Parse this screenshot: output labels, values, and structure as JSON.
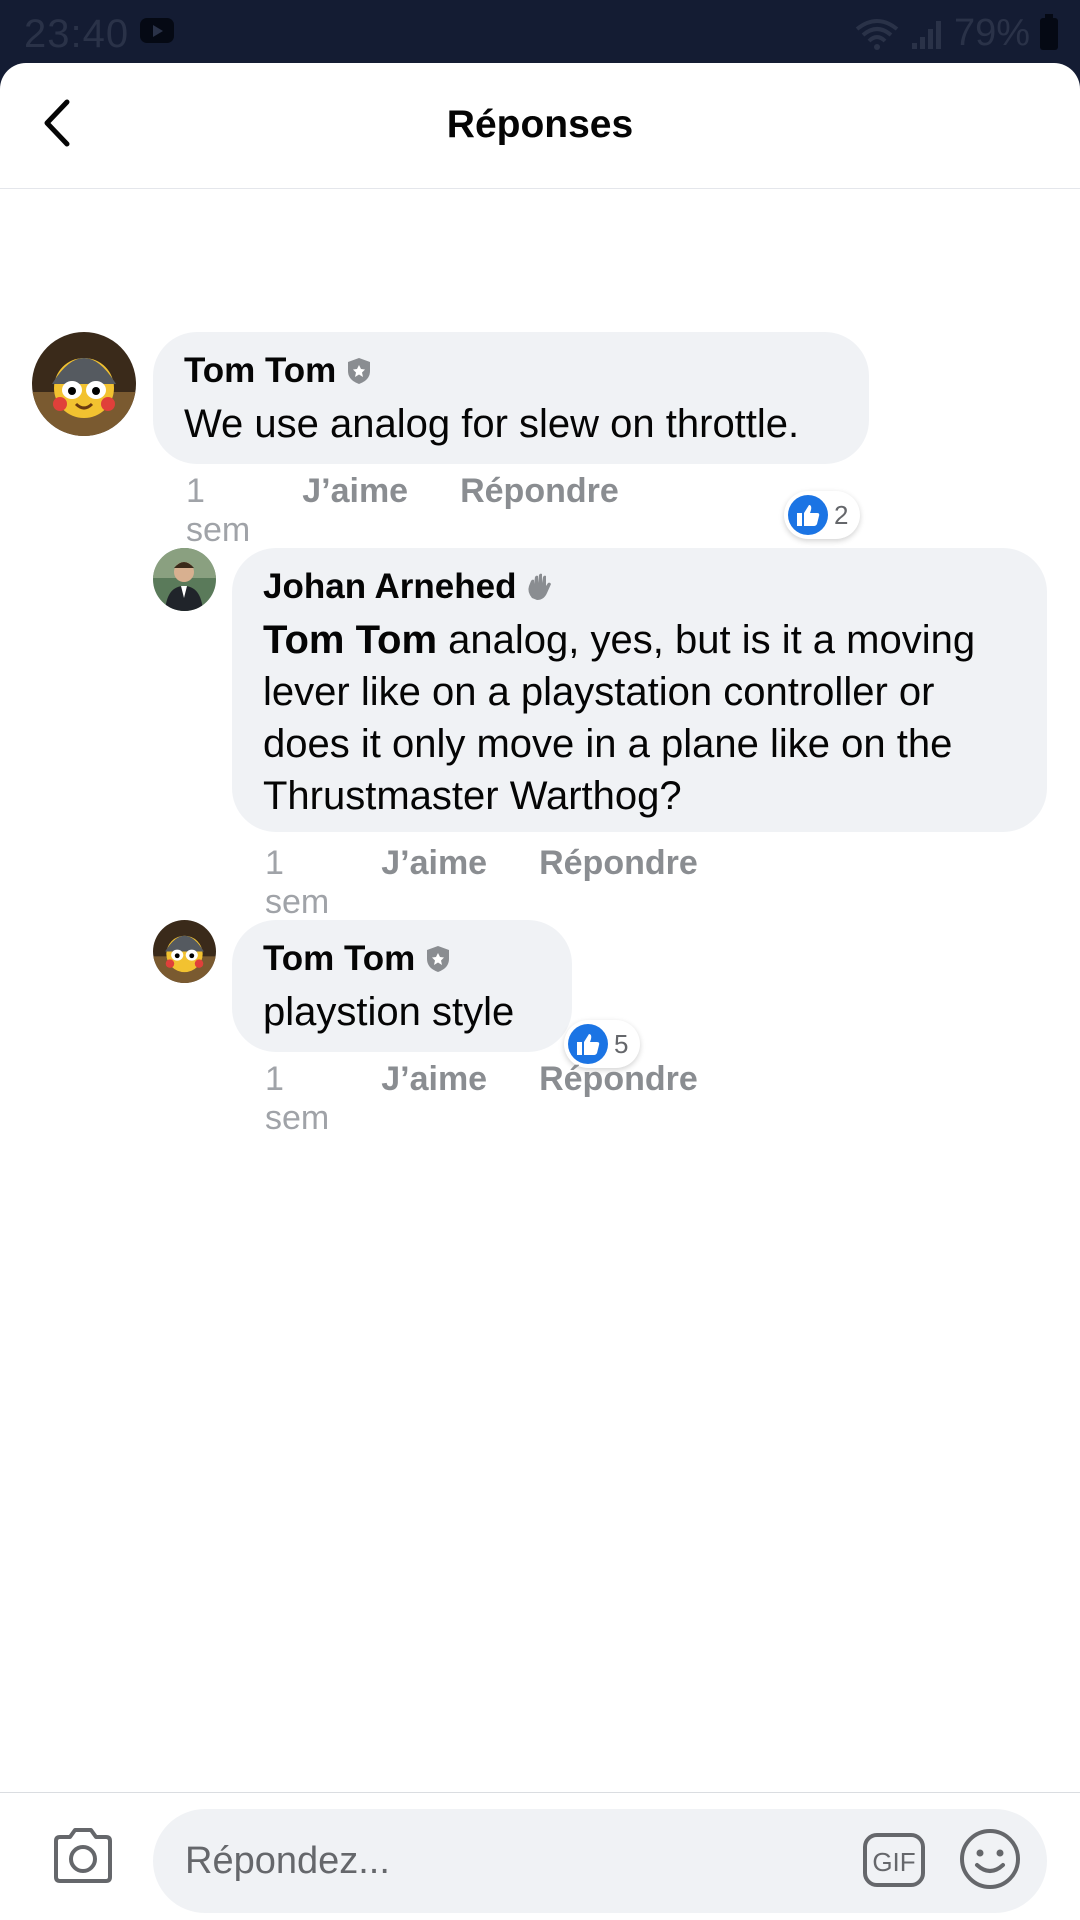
{
  "status_bar": {
    "time": "23:40",
    "battery": "79%"
  },
  "header": {
    "title": "Réponses"
  },
  "comments": [
    {
      "author": "Tom Tom",
      "text": "We use analog for slew on throttle.",
      "time": "1 sem",
      "like_label": "J’aime",
      "reply_label": "Répondre",
      "reactions": "2"
    },
    {
      "author": "Johan Arnehed",
      "mention": "Tom Tom",
      "text": " analog, yes, but is it a moving lever like on a playstation controller or does it only move in a plane like on the Thrustmaster Warthog?",
      "time": "1 sem",
      "like_label": "J’aime",
      "reply_label": "Répondre"
    },
    {
      "author": "Tom Tom",
      "text": "playstion style",
      "time": "1 sem",
      "like_label": "J’aime",
      "reply_label": "Répondre",
      "reactions": "5"
    }
  ],
  "composer": {
    "placeholder": "Répondez...",
    "gif_label": "GIF"
  },
  "colors": {
    "accent": "#1b74e4",
    "bubble": "#f0f2f5",
    "muted": "#8a8d91",
    "status_bar": "#141c33"
  }
}
